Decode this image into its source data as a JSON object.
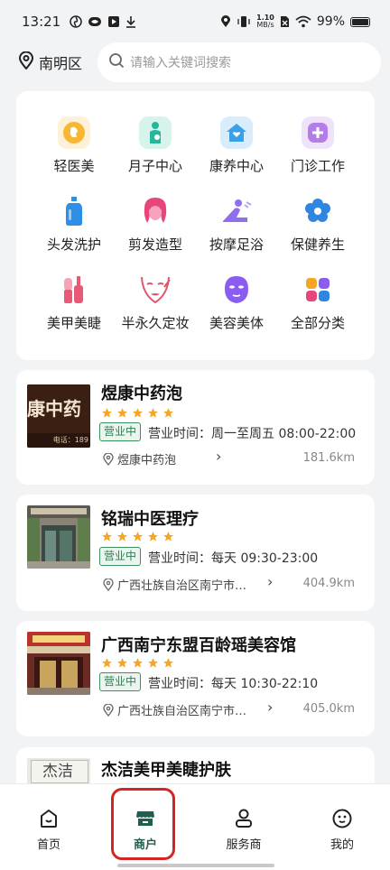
{
  "status_bar": {
    "time": "13:21",
    "net_speed_top": "1.10",
    "net_speed_bottom": "MB/s",
    "battery": "99%"
  },
  "header": {
    "location": "南明区",
    "search_placeholder": "请输入关键词搜索"
  },
  "categories": [
    {
      "label": "轻医美",
      "icon": "light-beauty-icon",
      "color": "#f7b733"
    },
    {
      "label": "月子中心",
      "icon": "maternity-icon",
      "color": "#29b59a"
    },
    {
      "label": "康养中心",
      "icon": "wellness-home-icon",
      "color": "#3aa0e8"
    },
    {
      "label": "门诊工作",
      "icon": "clinic-icon",
      "color": "#b57de8"
    },
    {
      "label": "头发洗护",
      "icon": "hair-wash-icon",
      "color": "#2f8fe6"
    },
    {
      "label": "剪发造型",
      "icon": "haircut-icon",
      "color": "#e8457a"
    },
    {
      "label": "按摩足浴",
      "icon": "massage-icon",
      "color": "#8f6ef0"
    },
    {
      "label": "保健养生",
      "icon": "health-flower-icon",
      "color": "#2f86e0"
    },
    {
      "label": "美甲美睫",
      "icon": "nail-icon",
      "color": "#e85a76"
    },
    {
      "label": "半永久定妆",
      "icon": "makeup-face-icon",
      "color": "#e0566a"
    },
    {
      "label": "美容美体",
      "icon": "facial-mask-icon",
      "color": "#8b5cf0"
    },
    {
      "label": "全部分类",
      "icon": "all-categories-icon",
      "color": "#f5a623"
    }
  ],
  "shops": [
    {
      "name": "煜康中药泡",
      "rating": 5,
      "status": "营业中",
      "hours": "营业时间：周一至周五 08:00-22:00",
      "address": "煜康中药泡",
      "distance": "181.6km",
      "thumb_text": "康中药",
      "thumb_sub": "电话：189"
    },
    {
      "name": "铭瑞中医理疗",
      "rating": 5,
      "status": "营业中",
      "hours": "营业时间：每天 09:30-23:00",
      "address": "广西壮族自治区南宁市…",
      "distance": "404.9km"
    },
    {
      "name": "广西南宁东盟百龄瑶美容馆",
      "rating": 5,
      "status": "营业中",
      "hours": "营业时间：每天 10:30-22:10",
      "address": "广西壮族自治区南宁市…",
      "distance": "405.0km"
    },
    {
      "name": "杰洁美甲美睫护肤",
      "thumb_text": "杰洁"
    }
  ],
  "bottom_nav": [
    {
      "label": "首页",
      "icon": "home-icon"
    },
    {
      "label": "商户",
      "icon": "store-icon",
      "active": true
    },
    {
      "label": "服务商",
      "icon": "user-icon"
    },
    {
      "label": "我的",
      "icon": "smiley-icon"
    }
  ],
  "colors": {
    "accent_green": "#1f5f4f",
    "open_badge": "#2e7d4f",
    "star": "#f5a623",
    "highlight_red": "#d42525"
  }
}
